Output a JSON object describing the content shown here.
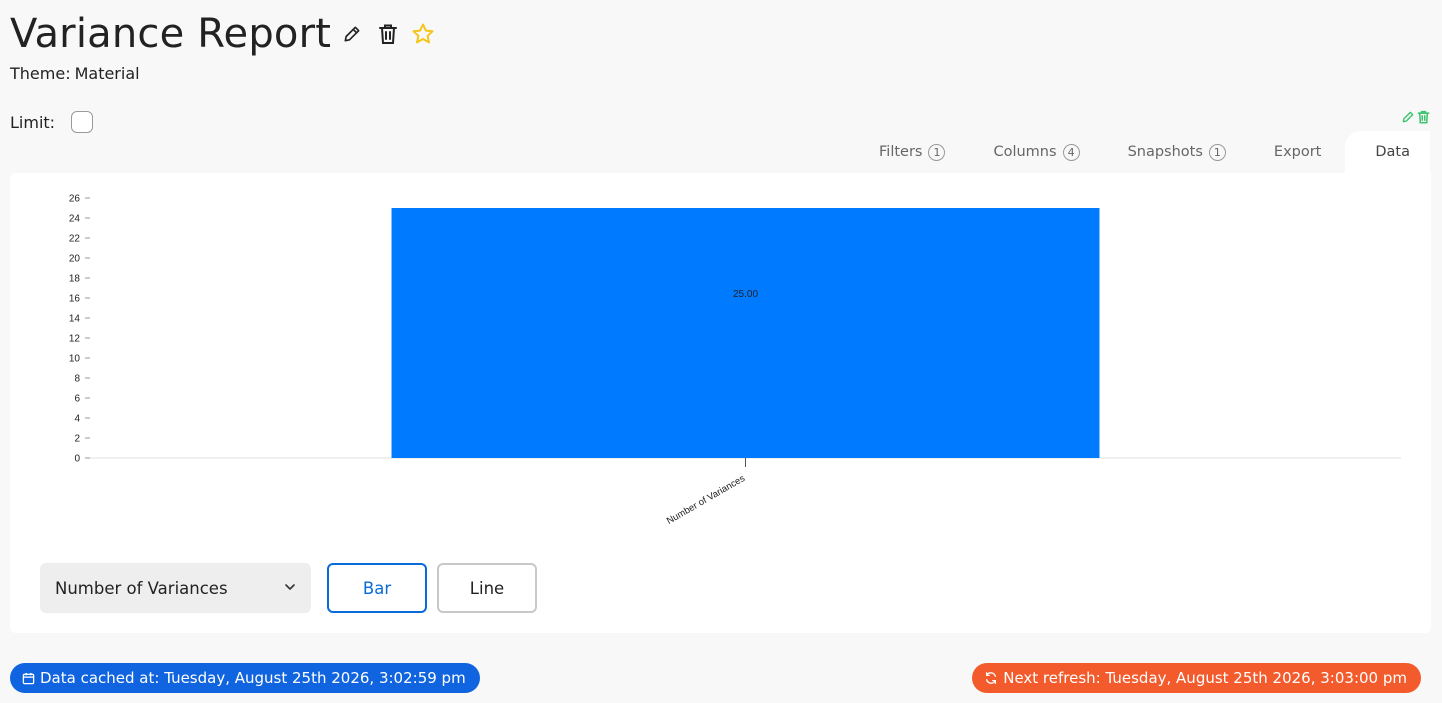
{
  "report": {
    "title": "Variance Report",
    "theme_label": "Theme:",
    "theme_value": "Material"
  },
  "limit": {
    "label": "Limit:",
    "checked": false
  },
  "tabs": [
    {
      "label": "Filters",
      "count": "1"
    },
    {
      "label": "Columns",
      "count": "4"
    },
    {
      "label": "Snapshots",
      "count": "1"
    },
    {
      "label": "Export",
      "count": null
    },
    {
      "label": "Data",
      "count": null,
      "active": true
    }
  ],
  "controls": {
    "series_select": "Number of Variances",
    "bar_label": "Bar",
    "line_label": "Line"
  },
  "footer": {
    "cached": "Data cached at: Tuesday, August 25th 2026, 3:02:59 pm",
    "refresh": "Next refresh: Tuesday, August 25th 2026, 3:03:00 pm"
  },
  "colors": {
    "bar": "#007bff",
    "accent_blue": "#1164e0",
    "accent_orange": "#f45b2c",
    "star": "#f5c518",
    "corner_icons": "#3cc46f"
  },
  "chart_data": {
    "type": "bar",
    "categories": [
      "Number of Variances"
    ],
    "values": [
      25
    ],
    "data_labels": [
      "25.00"
    ],
    "y_ticks": [
      0,
      2,
      4,
      6,
      8,
      10,
      12,
      14,
      16,
      18,
      20,
      22,
      24,
      26
    ],
    "ylim": [
      0,
      26
    ],
    "title": "",
    "xlabel": "",
    "ylabel": "",
    "grid": false,
    "legend": "none"
  }
}
